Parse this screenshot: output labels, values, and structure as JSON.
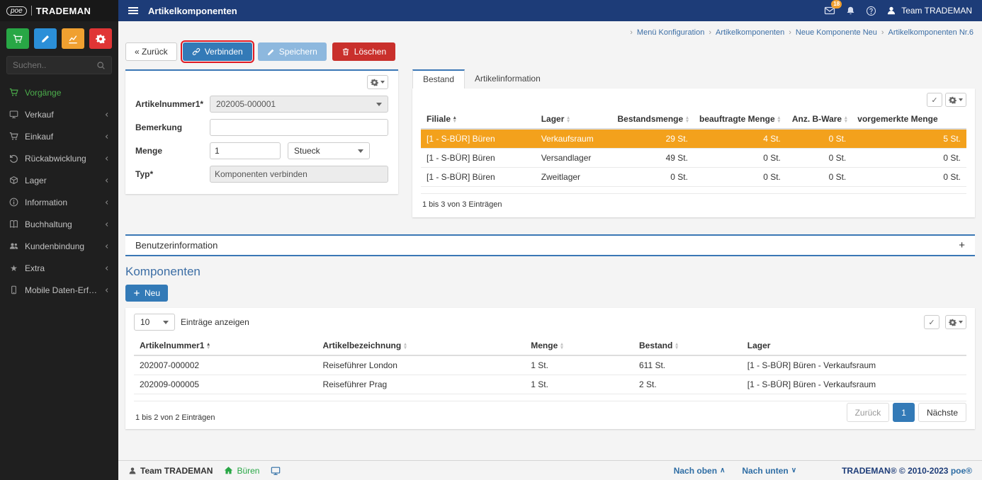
{
  "brand": {
    "poe": "poe",
    "name": "TRADEMAN"
  },
  "topbar": {
    "title": "Artikelkomponenten",
    "mail_badge": "18",
    "user": "Team TRADEMAN"
  },
  "sidebar": {
    "search_placeholder": "Suchen..",
    "items": [
      {
        "label": "Vorgänge",
        "icon": "cart"
      },
      {
        "label": "Verkauf",
        "icon": "monitor"
      },
      {
        "label": "Einkauf",
        "icon": "cart"
      },
      {
        "label": "Rückabwicklung",
        "icon": "undo"
      },
      {
        "label": "Lager",
        "icon": "box"
      },
      {
        "label": "Information",
        "icon": "info"
      },
      {
        "label": "Buchhaltung",
        "icon": "book"
      },
      {
        "label": "Kundenbindung",
        "icon": "users"
      },
      {
        "label": "Extra",
        "icon": "star"
      },
      {
        "label": "Mobile Daten-Erfassung",
        "icon": "mobile"
      }
    ]
  },
  "breadcrumb": {
    "separator": "›",
    "items": [
      "Menü Konfiguration",
      "Artikelkomponenten",
      "Neue Komponente Neu",
      "Artikelkomponenten Nr.6"
    ]
  },
  "toolbar": {
    "back": "« Zurück",
    "connect": "Verbinden",
    "save": "Speichern",
    "delete": "Löschen"
  },
  "form": {
    "artikelnummer_label": "Artikelnummer1*",
    "artikelnummer_value": "202005-000001",
    "bemerkung_label": "Bemerkung",
    "bemerkung_value": "",
    "menge_label": "Menge",
    "menge_value": "1",
    "einheit_value": "Stueck",
    "typ_label": "Typ*",
    "typ_value": "Komponenten verbinden"
  },
  "bestand": {
    "tab_bestand": "Bestand",
    "tab_artikelinfo": "Artikelinformation",
    "columns": [
      "Filiale",
      "Lager",
      "Bestandsmenge",
      "beauftragte Menge",
      "Anz. B-Ware",
      "vorgemerkte Menge"
    ],
    "rows": [
      [
        "[1 - S-BÜR] Büren",
        "Verkaufsraum",
        "29 St.",
        "4 St.",
        "0 St.",
        "5 St."
      ],
      [
        "[1 - S-BÜR] Büren",
        "Versandlager",
        "49 St.",
        "0 St.",
        "0 St.",
        "0 St."
      ],
      [
        "[1 - S-BÜR] Büren",
        "Zweitlager",
        "0 St.",
        "0 St.",
        "0 St.",
        "0 St."
      ]
    ],
    "summary": "1 bis 3 von 3 Einträgen"
  },
  "benutzerinformation": {
    "title": "Benutzerinformation",
    "expand": "+"
  },
  "komponenten": {
    "title": "Komponenten",
    "neu": "Neu",
    "page_size": "10",
    "entries_label": "Einträge anzeigen",
    "columns": [
      "Artikelnummer1",
      "Artikelbezeichnung",
      "Menge",
      "Bestand",
      "Lager"
    ],
    "rows": [
      [
        "202007-000002",
        "Reiseführer London",
        "1 St.",
        "611 St.",
        "[1 - S-BÜR] Büren - Verkaufsraum"
      ],
      [
        "202009-000005",
        "Reiseführer Prag",
        "1 St.",
        "2 St.",
        "[1 - S-BÜR] Büren - Verkaufsraum"
      ]
    ],
    "summary": "1 bis 2 von 2 Einträgen",
    "pager": {
      "prev": "Zurück",
      "page": "1",
      "next": "Nächste"
    }
  },
  "footer": {
    "user": "Team TRADEMAN",
    "location": "Büren",
    "up": "Nach oben",
    "down": "Nach unten",
    "copyright": "TRADEMAN® © 2010-2023",
    "copyright_brand": "poe®"
  },
  "colors": {
    "topbar": "#1d3c78",
    "card_accent": "#3a77b5",
    "primary": "#337ab7",
    "danger": "#c9302c",
    "highlight_row": "#f3a11c",
    "badge": "#f0a030",
    "sidebar": "#1f1f1f"
  }
}
